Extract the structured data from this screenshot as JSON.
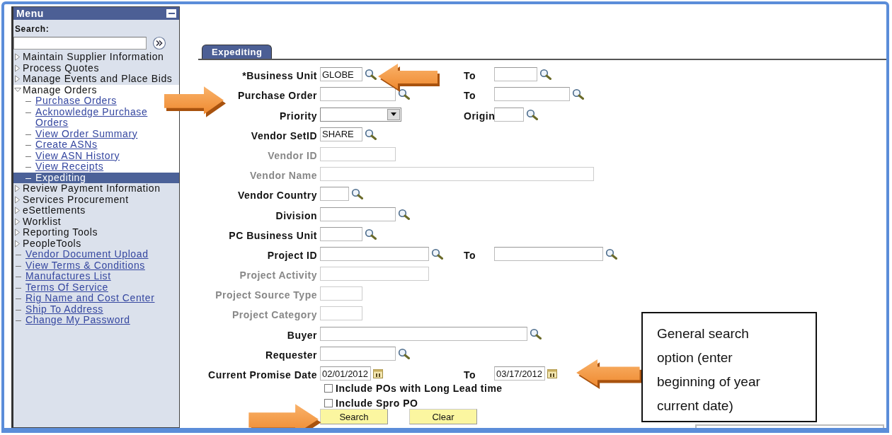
{
  "menu": {
    "title": "Menu",
    "search_label": "Search:",
    "items": [
      {
        "kind": "folder",
        "label": "Maintain Supplier Information",
        "expanded": false
      },
      {
        "kind": "folder",
        "label": "Process Quotes",
        "expanded": false
      },
      {
        "kind": "folder",
        "label": "Manage Events and Place Bids",
        "expanded": false
      },
      {
        "kind": "folder",
        "label": "Manage Orders",
        "expanded": true,
        "children": [
          {
            "label": "Purchase Orders",
            "selected": false
          },
          {
            "label": "Acknowledge Purchase Orders",
            "selected": false
          },
          {
            "label": "View Order Summary",
            "selected": false
          },
          {
            "label": "Create ASNs",
            "selected": false
          },
          {
            "label": "View ASN History",
            "selected": false
          },
          {
            "label": "View Receipts",
            "selected": false
          },
          {
            "label": "Expediting",
            "selected": true
          }
        ]
      },
      {
        "kind": "folder",
        "label": "Review Payment Information",
        "expanded": false
      },
      {
        "kind": "folder",
        "label": "Services Procurement",
        "expanded": false
      },
      {
        "kind": "folder",
        "label": "eSettlements",
        "expanded": false
      },
      {
        "kind": "folder",
        "label": "Worklist",
        "expanded": false
      },
      {
        "kind": "folder",
        "label": "Reporting Tools",
        "expanded": false
      },
      {
        "kind": "folder",
        "label": "PeopleTools",
        "expanded": false
      },
      {
        "kind": "link",
        "label": "Vendor Document Upload",
        "selected": false
      },
      {
        "kind": "link",
        "label": "View Terms & Conditions",
        "selected": false
      },
      {
        "kind": "link",
        "label": "Manufactures List",
        "selected": false
      },
      {
        "kind": "link",
        "label": "Terms Of Service",
        "selected": false
      },
      {
        "kind": "link",
        "label": "Rig Name and Cost Center",
        "selected": false
      },
      {
        "kind": "link",
        "label": "Ship To Address",
        "selected": false
      },
      {
        "kind": "link",
        "label": "Change My Password",
        "selected": false
      }
    ]
  },
  "tab": {
    "label": "Expediting",
    "selected": true
  },
  "form": {
    "rows": [
      {
        "label": "*Business Unit",
        "disabled": false,
        "field": {
          "kind": "text",
          "value": "GLOBE",
          "lookup": true
        },
        "second": {
          "label": "To",
          "field": {
            "kind": "text",
            "lookup": true
          }
        }
      },
      {
        "label": "Purchase Order",
        "disabled": false,
        "field": {
          "kind": "text",
          "lookup": true
        },
        "second": {
          "label": "To",
          "field": {
            "kind": "text",
            "lookup": true
          }
        }
      },
      {
        "label": "Priority",
        "disabled": false,
        "field": {
          "kind": "select",
          "lookup": false
        },
        "second": {
          "label": "Origin",
          "field": {
            "kind": "text",
            "lookup": true
          }
        }
      },
      {
        "label": "Vendor SetID",
        "disabled": false,
        "field": {
          "kind": "text",
          "value": "SHARE",
          "lookup": true
        }
      },
      {
        "label": "Vendor ID",
        "disabled": true,
        "field": {
          "kind": "text",
          "lookup": false
        }
      },
      {
        "label": "Vendor Name",
        "disabled": true,
        "field": {
          "kind": "text",
          "lookup": false
        }
      },
      {
        "label": "Vendor Country",
        "disabled": false,
        "field": {
          "kind": "text",
          "lookup": true
        }
      },
      {
        "label": "Division",
        "disabled": false,
        "field": {
          "kind": "text",
          "lookup": true
        }
      },
      {
        "label": "PC Business Unit",
        "disabled": false,
        "field": {
          "kind": "text",
          "lookup": true
        }
      },
      {
        "label": "Project ID",
        "disabled": false,
        "field": {
          "kind": "text",
          "lookup": true
        },
        "second": {
          "label": "To",
          "field": {
            "kind": "text",
            "lookup": true
          }
        }
      },
      {
        "label": "Project Activity",
        "disabled": true,
        "field": {
          "kind": "text",
          "lookup": false
        }
      },
      {
        "label": "Project Source Type",
        "disabled": true,
        "field": {
          "kind": "text",
          "lookup": false
        }
      },
      {
        "label": "Project Category",
        "disabled": true,
        "field": {
          "kind": "text",
          "lookup": false
        }
      },
      {
        "label": "Buyer",
        "disabled": false,
        "field": {
          "kind": "text",
          "lookup": true
        }
      },
      {
        "label": "Requester",
        "disabled": false,
        "field": {
          "kind": "text",
          "lookup": true
        }
      },
      {
        "label": "Current Promise Date",
        "disabled": false,
        "field": {
          "kind": "date",
          "value": "02/01/2012"
        },
        "second": {
          "label": "To",
          "field": {
            "kind": "date",
            "value": "03/17/2012"
          }
        }
      }
    ],
    "checkboxes": [
      {
        "label": "Include POs with Long Lead time",
        "checked": false
      },
      {
        "label": "Include Spro PO",
        "checked": false
      }
    ],
    "buttons": [
      "Search",
      "Clear"
    ]
  },
  "callout": {
    "text": "General search option (enter beginning of year current date)"
  }
}
